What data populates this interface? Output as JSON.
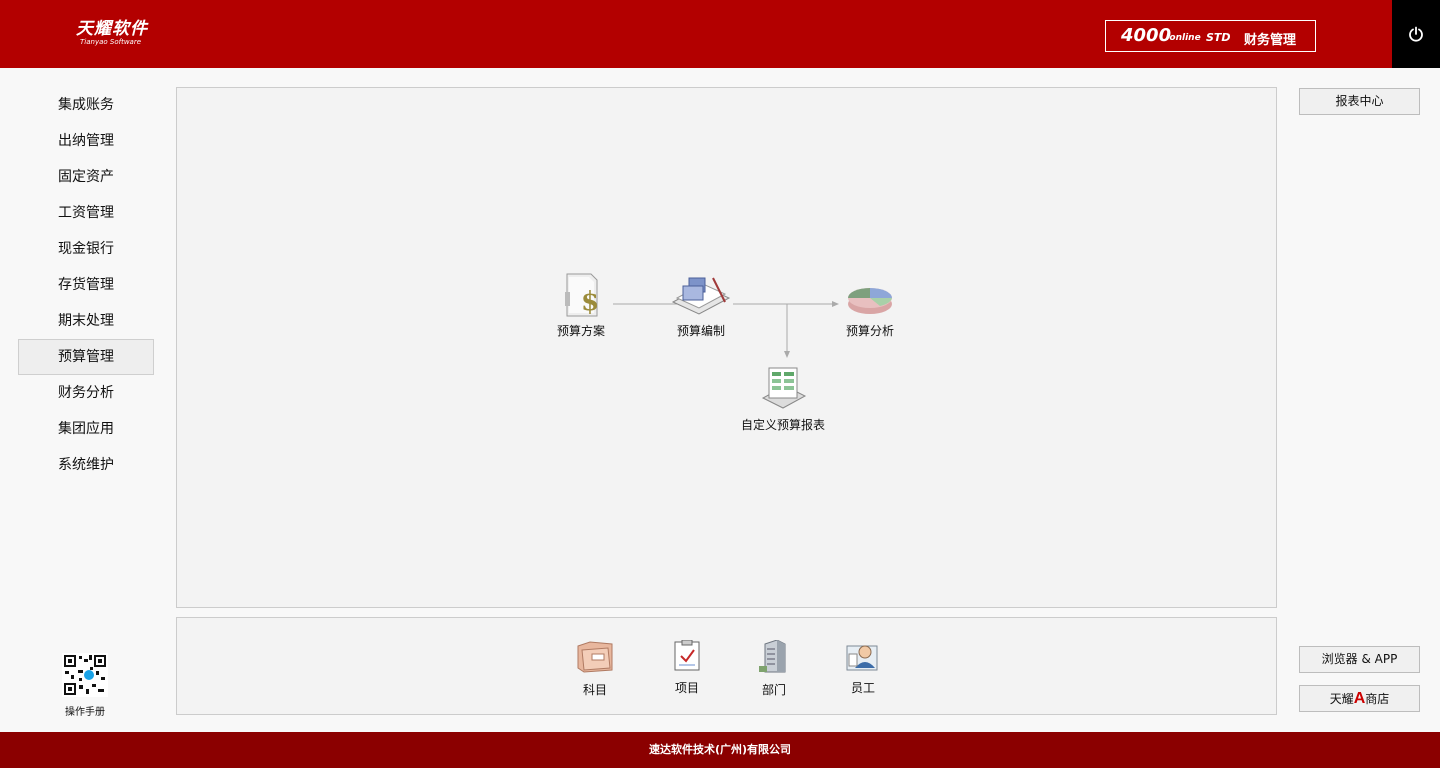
{
  "header": {
    "logo_cn": "天耀软件",
    "logo_en": "Tianyao Software",
    "product_number": "4000",
    "product_online": ".online",
    "product_edition": "STD",
    "product_name": "财务管理"
  },
  "nav": {
    "items": [
      {
        "label": "集成账务"
      },
      {
        "label": "出纳管理"
      },
      {
        "label": "固定资产"
      },
      {
        "label": "工资管理"
      },
      {
        "label": "现金银行"
      },
      {
        "label": "存货管理"
      },
      {
        "label": "期末处理"
      },
      {
        "label": "预算管理",
        "active": true
      },
      {
        "label": "财务分析"
      },
      {
        "label": "集团应用"
      },
      {
        "label": "系统维护"
      }
    ],
    "manual_label": "操作手册"
  },
  "flow": {
    "plan": "预算方案",
    "compile": "预算编制",
    "analysis": "预算分析",
    "custom_report": "自定义预算报表"
  },
  "basics": {
    "subject": "科目",
    "project": "项目",
    "department": "部门",
    "employee": "员工"
  },
  "right": {
    "report_center": "报表中心",
    "browser_app": "浏览器 & APP",
    "store_prefix": "天耀",
    "store_letter": "A",
    "store_suffix": "商店"
  },
  "footer": {
    "company": "速达软件技术(广州)有限公司"
  },
  "colors": {
    "header_red": "#b30000",
    "footer_red": "#8b0000",
    "power_bg": "#000000"
  }
}
